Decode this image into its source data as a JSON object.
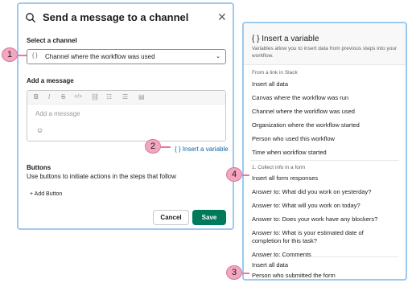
{
  "dialog": {
    "title": "Send a message to a channel",
    "select_channel_label": "Select a channel",
    "channel_var_icon": "{ }",
    "channel_value": "Channel where the workflow was used",
    "add_message_label": "Add a message",
    "toolbar": [
      "B",
      "I",
      "S",
      "</>",
      "link",
      "ol",
      "ul",
      "quote"
    ],
    "message_placeholder": "Add a message",
    "insert_variable_link": "{ } Insert a variable",
    "buttons_heading": "Buttons",
    "buttons_description": "Use buttons to initiate actions in the steps that follow",
    "add_button_label": "+ Add Button",
    "cancel_label": "Cancel",
    "save_label": "Save"
  },
  "panel": {
    "title": "{ } Insert a variable",
    "description": "Variables allow you to insert data from previous steps into your workflow.",
    "section1_head": "From a link in Slack",
    "section1_items": [
      "Insert all data",
      "Canvas where the workflow was run",
      "Channel where the workflow was used",
      "Organization where the workflow started",
      "Person who used this workflow",
      "Time when workflow started"
    ],
    "section2_head": "1. Collect info in a form",
    "section2_items": [
      "Insert all form responses",
      "Answer to: What did you work on yesterday?",
      "Answer to: What will you work on today?",
      "Answer to: Does your work have any blockers?",
      "Answer to: What is your estimated date of",
      "completion for this task?",
      "Answer to: Comments"
    ],
    "section3_items": [
      "Insert all data",
      "Person who submitted the form"
    ]
  },
  "callouts": [
    "1",
    "2",
    "3",
    "4"
  ],
  "colors": {
    "save_button": "#007a5a",
    "link": "#1264a3",
    "highlight_border": "#9cc9f0",
    "callout": "#f4a6c0"
  }
}
